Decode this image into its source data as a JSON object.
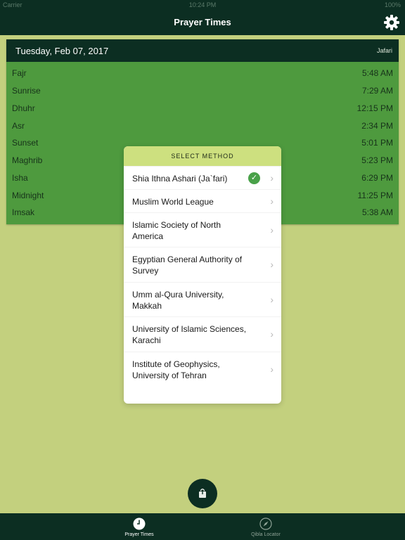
{
  "status": {
    "carrier": "Carrier",
    "time": "10:24 PM",
    "battery": "100%"
  },
  "nav": {
    "title": "Prayer Times",
    "settings_icon": "gear-icon"
  },
  "card": {
    "date": "Tuesday, Feb 07, 2017",
    "method": "Jafari",
    "prayers": [
      {
        "name": "Fajr",
        "time": "5:48 AM"
      },
      {
        "name": "Sunrise",
        "time": "7:29 AM"
      },
      {
        "name": "Dhuhr",
        "time": "12:15 PM"
      },
      {
        "name": "Asr",
        "time": "2:34 PM"
      },
      {
        "name": "Sunset",
        "time": "5:01 PM"
      },
      {
        "name": "Maghrib",
        "time": "5:23 PM"
      },
      {
        "name": "Isha",
        "time": "6:29 PM"
      },
      {
        "name": "Midnight",
        "time": "11:25 PM"
      },
      {
        "name": "Imsak",
        "time": "5:38 AM"
      }
    ]
  },
  "popover": {
    "title": "SELECT METHOD",
    "options": [
      {
        "label": "Shia Ithna Ashari (Ja`fari)",
        "selected": true
      },
      {
        "label": "Muslim World League",
        "selected": false
      },
      {
        "label": "Islamic Society of North America",
        "selected": false
      },
      {
        "label": "Egyptian General Authority of Survey",
        "selected": false
      },
      {
        "label": "Umm al-Qura University, Makkah",
        "selected": false
      },
      {
        "label": "University of Islamic Sciences, Karachi",
        "selected": false
      },
      {
        "label": "Institute of Geophysics, University of Tehran",
        "selected": false
      }
    ]
  },
  "fab": {
    "icon": "share-icon"
  },
  "tabs": [
    {
      "label": "Prayer Times",
      "icon": "clock-icon",
      "active": true
    },
    {
      "label": "Qibla Locator",
      "icon": "compass-icon",
      "active": false
    }
  ],
  "colors": {
    "dark_green": "#0c2e22",
    "card_green": "#4e9a3e",
    "background": "#c3d07e",
    "popover_header": "#cde07f",
    "check_green": "#49a149"
  }
}
